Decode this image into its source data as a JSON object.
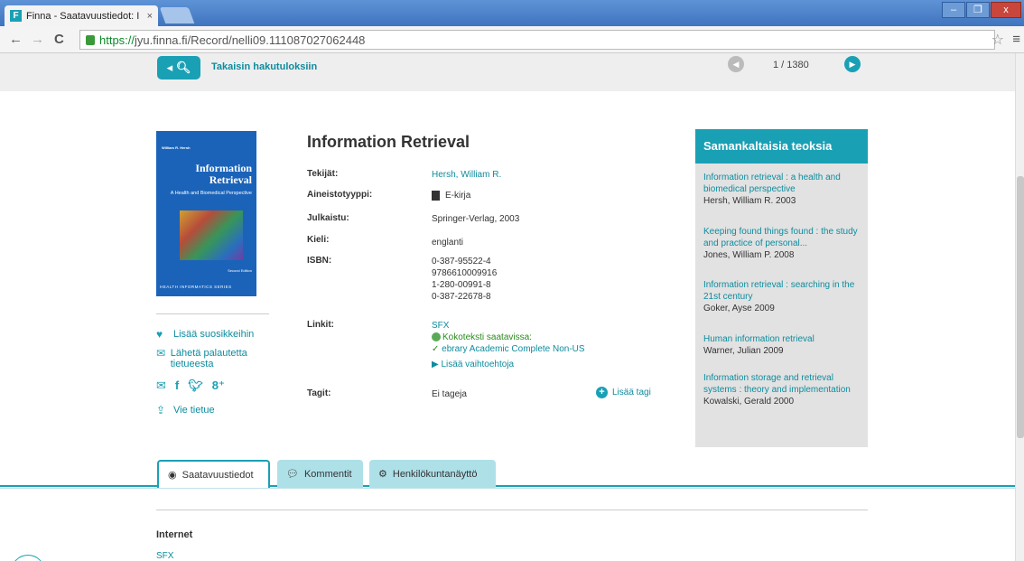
{
  "browser": {
    "tab_title": "Finna - Saatavuustiedot: I",
    "tab_close": "×",
    "favicon_letter": "F",
    "url_https": "https://",
    "url_rest": "jyu.finna.fi/Record/nelli09.111087027062448",
    "win_min": "–",
    "win_max": "❐",
    "win_close": "x"
  },
  "topbar": {
    "back_label": "Takaisin hakutuloksiin",
    "pager_count": "1 / 1380"
  },
  "cover": {
    "author": "William R. Hersh",
    "title": "Information Retrieval",
    "subtitle": "A Health and Biomedical Perspective",
    "edition": "Second Edition",
    "series": "HEALTH INFORMATICS SERIES"
  },
  "sidebar": {
    "favorite": "Lisää suosikkeihin",
    "feedback": "Lähetä palautetta tietueesta",
    "export": "Vie tietue"
  },
  "record": {
    "title": "Information Retrieval",
    "fields": {
      "authors_label": "Tekijät:",
      "authors_value": "Hersh, William R.",
      "type_label": "Aineistotyyppi:",
      "type_value": "E-kirja",
      "published_label": "Julkaistu:",
      "published_value": "Springer-Verlag, 2003",
      "language_label": "Kieli:",
      "language_value": "englanti",
      "isbn_label": "ISBN:",
      "isbn_values": [
        "0-387-95522-4",
        "9786610009916",
        "1-280-00991-8",
        "0-387-22678-8"
      ],
      "links_label": "Linkit:",
      "links_sfx": "SFX",
      "links_fulltext": "Kokoteksti saatavissa:",
      "links_ebrary": "ebrary Academic Complete Non-US",
      "links_more": "Lisää vaihtoehtoja",
      "tags_label": "Tagit:",
      "tags_value": "Ei tageja",
      "add_tag": "Lisää tagi"
    }
  },
  "similar": {
    "heading": "Samankaltaisia teoksia",
    "items": [
      {
        "title": "Information retrieval : a health and biomedical perspective",
        "meta": "Hersh, William R. 2003"
      },
      {
        "title": "Keeping found things found : the study and practice of personal...",
        "meta": "Jones, William P. 2008"
      },
      {
        "title": "Information retrieval : searching in the 21st century",
        "meta": "Goker, Ayse 2009"
      },
      {
        "title": "Human information retrieval",
        "meta": "Warner, Julian 2009"
      },
      {
        "title": "Information storage and retrieval systems : theory and implementation",
        "meta": "Kowalski, Gerald 2000"
      }
    ]
  },
  "tabs": {
    "availability": "Saatavuustiedot",
    "comments": "Kommentit",
    "staff_view": "Henkilökuntanäyttö"
  },
  "holdings": {
    "heading": "Internet",
    "sfx": "SFX"
  }
}
